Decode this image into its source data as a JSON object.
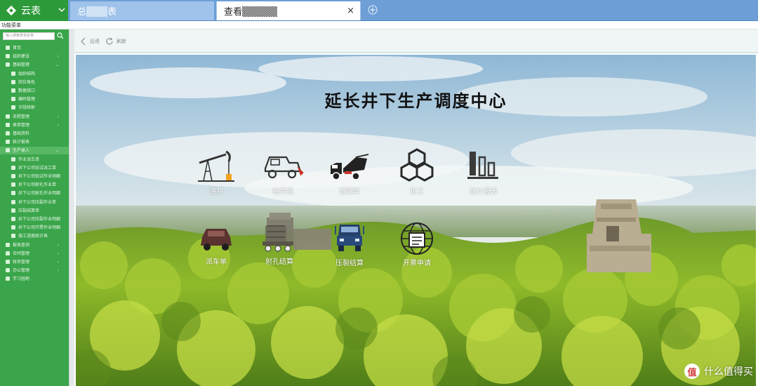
{
  "app": {
    "logo_text": "云表",
    "tabs": [
      {
        "label": "总▒▒▒表"
      },
      {
        "label": "查看▒▒▒▒▒"
      }
    ],
    "close_tab_glyph": "×"
  },
  "menu_line": "功能菜单",
  "sidebar": {
    "search_placeholder": "输入搜索表单名称",
    "items": [
      {
        "label": "首页"
      },
      {
        "label": "组织建设"
      },
      {
        "label": "基础管理"
      },
      {
        "label": "组织结构"
      },
      {
        "label": "岗位角色"
      },
      {
        "label": "数据接口"
      },
      {
        "label": "编码管理"
      },
      {
        "label": "字段映射"
      },
      {
        "label": "流程管理"
      },
      {
        "label": "表单管理"
      },
      {
        "label": "基础资料"
      },
      {
        "label": "统计报表"
      },
      {
        "label": "生产录入"
      },
      {
        "label": "作业派车单"
      },
      {
        "label": "井下公司钻试派工单"
      },
      {
        "label": "井下公司钻试作业明细"
      },
      {
        "label": "井下公司射孔作业单"
      },
      {
        "label": "井下公司射孔作业明细"
      },
      {
        "label": "井下公司压裂作业单"
      },
      {
        "label": "压裂结算单"
      },
      {
        "label": "井下公司压裂作业明细"
      },
      {
        "label": "井下公司开票作业明细"
      },
      {
        "label": "施工进度统计表"
      },
      {
        "label": "报表查询"
      },
      {
        "label": "合同管理"
      },
      {
        "label": "财务管理"
      },
      {
        "label": "办公管理"
      },
      {
        "label": "学习园地"
      }
    ]
  },
  "toolbar": {
    "back_label": "后退",
    "refresh_label": "刷新"
  },
  "hero": {
    "title": "延长井下生产调度中心"
  },
  "tiles": [
    {
      "label": "油井"
    },
    {
      "label": "钻井机"
    },
    {
      "label": "运输车"
    },
    {
      "label": "化工"
    },
    {
      "label": "统计报表"
    },
    {
      "label": "派车单"
    },
    {
      "label": "射孔结算"
    },
    {
      "label": "压裂结算"
    },
    {
      "label": "开票申请"
    }
  ],
  "watermark": {
    "badge": "值",
    "text": "什么值得买"
  },
  "colors": {
    "sidebar_green": "#3aa54a",
    "tab_blue": "#6d9fd6"
  }
}
